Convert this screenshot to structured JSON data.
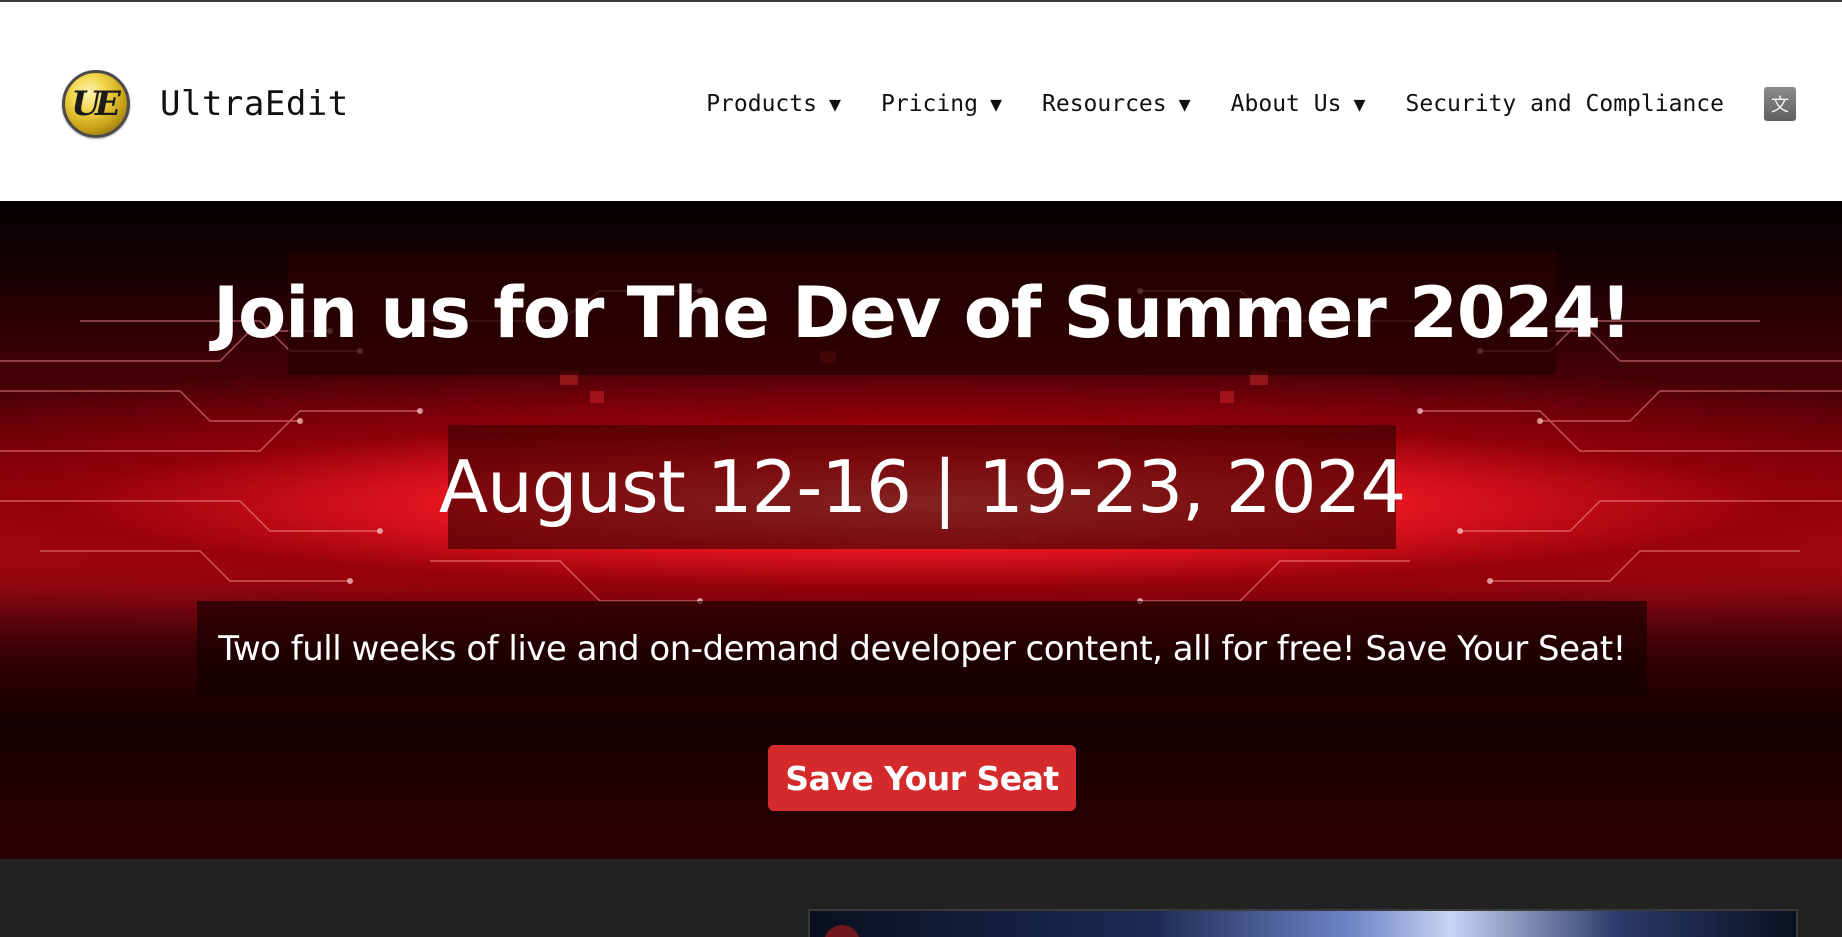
{
  "brand": {
    "name": "UltraEdit",
    "logo_icon": "ultraedit-logo-icon",
    "logo_mark": "UE"
  },
  "nav": {
    "items": [
      {
        "label": "Products",
        "caret": "▼"
      },
      {
        "label": "Pricing",
        "caret": "▼"
      },
      {
        "label": "Resources",
        "caret": "▼"
      },
      {
        "label": "About Us",
        "caret": "▼"
      },
      {
        "label": "Security and Compliance",
        "caret": ""
      }
    ],
    "translate_icon": "translate-icon",
    "translate_glyph": "文"
  },
  "hero": {
    "title": "Join us for The Dev of Summer 2024!",
    "dates": "August 12-16 | 19-23, 2024",
    "subtitle": "Two full weeks of live and on-demand developer content, all for free! Save Your Seat!",
    "cta_label": "Save Your Seat"
  },
  "colors": {
    "header_bg": "#ffffff",
    "hero_red": "#e51520",
    "cta_bg": "#d42a2b",
    "dark_section_bg": "#222222"
  }
}
